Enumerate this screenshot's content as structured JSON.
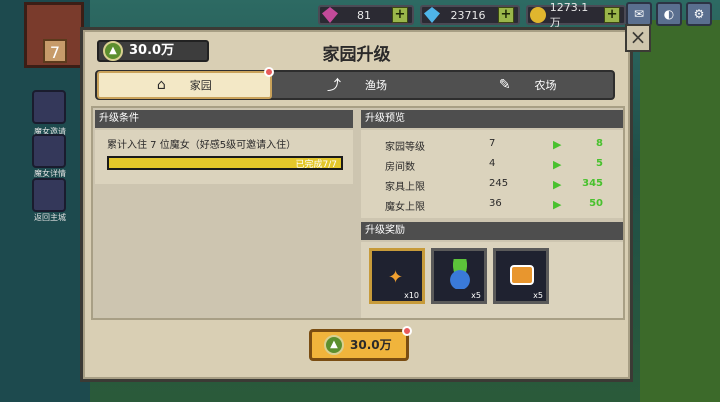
{
  "topbar": {
    "gems": "81",
    "diamonds": "23716",
    "coins": "1273.1万"
  },
  "home": {
    "level": "7"
  },
  "side": [
    {
      "label": "魔女邀请"
    },
    {
      "label": "魔女详情"
    },
    {
      "label": "返回主城"
    }
  ],
  "modal": {
    "title": "家园升级",
    "cost": "30.0万",
    "close": "×"
  },
  "tabs": [
    {
      "label": "家园",
      "active": true
    },
    {
      "label": "渔场",
      "active": false
    },
    {
      "label": "农场",
      "active": false
    }
  ],
  "conditions": {
    "header": "升级条件",
    "text": "累计入住 7 位魔女（好感5级可邀请入住）",
    "progress_label": "已完成7/7",
    "progress_fraction": 1.0
  },
  "preview": {
    "header": "升级预览",
    "rows": [
      {
        "label": "家园等级",
        "current": "7",
        "next": "8"
      },
      {
        "label": "房间数",
        "current": "4",
        "next": "5"
      },
      {
        "label": "家具上限",
        "current": "245",
        "next": "345"
      },
      {
        "label": "魔女上限",
        "current": "36",
        "next": "50"
      }
    ]
  },
  "rewards": {
    "header": "升级奖励",
    "items": [
      {
        "icon": "sparkle-seeds-icon",
        "qty": "x10"
      },
      {
        "icon": "sprout-flower-icon",
        "qty": "x5"
      },
      {
        "icon": "gift-box-icon",
        "qty": "x5"
      }
    ]
  },
  "upgrade_button": {
    "label": "30.0万"
  }
}
